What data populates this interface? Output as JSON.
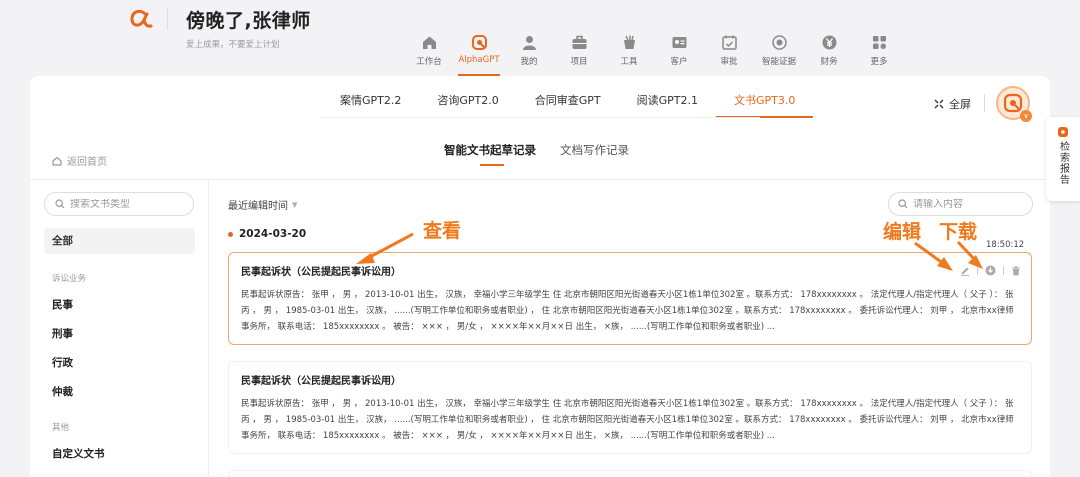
{
  "header": {
    "greeting": "傍晚了,张律师",
    "slogan": "爱上成果，不要爱上计划"
  },
  "nav": [
    {
      "label": "工作台",
      "icon": "home-icon"
    },
    {
      "label": "AlphaGPT",
      "icon": "alphagpt-icon",
      "active": true
    },
    {
      "label": "我的",
      "icon": "user-icon"
    },
    {
      "label": "项目",
      "icon": "briefcase-icon"
    },
    {
      "label": "工具",
      "icon": "tools-icon"
    },
    {
      "label": "客户",
      "icon": "contact-card-icon"
    },
    {
      "label": "审批",
      "icon": "approval-icon"
    },
    {
      "label": "智能证据",
      "icon": "evidence-icon"
    },
    {
      "label": "财务",
      "icon": "yen-icon"
    },
    {
      "label": "更多",
      "icon": "grid-icon"
    }
  ],
  "tabs": [
    "案情GPT2.2",
    "咨询GPT2.0",
    "合同审查GPT",
    "阅读GPT2.1",
    "文书GPT3.0"
  ],
  "active_tab_index": 4,
  "fullscreen_label": "全屏",
  "back_home": "返回首页",
  "subtabs": [
    "智能文书起草记录",
    "文档写作记录"
  ],
  "left": {
    "search_placeholder": "搜索文书类型",
    "all_label": "全部",
    "group1": "诉讼业务",
    "cats1": [
      "民事",
      "刑事",
      "行政",
      "仲裁"
    ],
    "group2": "其他",
    "cats2": [
      "自定义文书"
    ]
  },
  "main": {
    "sort_label": "最近编辑时间",
    "search_placeholder": "请输入内容",
    "date": "2024-03-20",
    "time": "18:50:12",
    "docs": [
      {
        "title": "民事起诉状（公民提起民事诉讼用）",
        "body": "民事起诉状原告：  张甲 ，  男 ，  2013-10-01 出生，  汉族，  幸福小学三年级学生 住 北京市朝阳区阳光街道春天小区1栋1单位302室 。联系方式：  178xxxxxxxx 。 法定代理人/指定代理人（ 父子 ）：  张丙 ，  男 ，  1985-03-01 出生，  汉族，  ......(写明工作单位和职务或者职业) ，  住 北京市朝阳区阳光街道春天小区1栋1单位302室 。联系方式：  178xxxxxxxx 。 委托诉讼代理人：  刘甲 ，  北京市xx律师事务所，  联系电话：  185xxxxxxxx 。 被告：  ××× ，  男/女 ，  ××××年××月××日 出生，  ×族，  ......(写明工作单位和职务或者职业) ..."
      },
      {
        "title": "民事起诉状（公民提起民事诉讼用）",
        "body": "民事起诉状原告：  张甲 ，  男 ，  2013-10-01 出生，  汉族，  幸福小学三年级学生 住 北京市朝阳区阳光街道春天小区1栋1单位302室 。联系方式：  178xxxxxxxx 。 法定代理人/指定代理人（ 父子 ）：  张丙 ，  男 ，  1985-03-01 出生，  汉族，  ......(写明工作单位和职务或者职业) ，  住 北京市朝阳区阳光街道春天小区1栋1单位302室 。联系方式：  178xxxxxxxx 。 委托诉讼代理人：  刘甲 ，  北京市xx律师事务所，  联系电话：  185xxxxxxxx 。 被告：  ××× ，  男/女 ，  ××××年××月××日 出生，  ×族，  ......(写明工作单位和职务或者职业) ..."
      }
    ]
  },
  "annotations": {
    "view": "查看",
    "edit": "编辑",
    "download": "下载"
  },
  "side_float_label": "检索报告",
  "colors": {
    "accent": "#e8671d",
    "annotation": "#f07a1d"
  }
}
